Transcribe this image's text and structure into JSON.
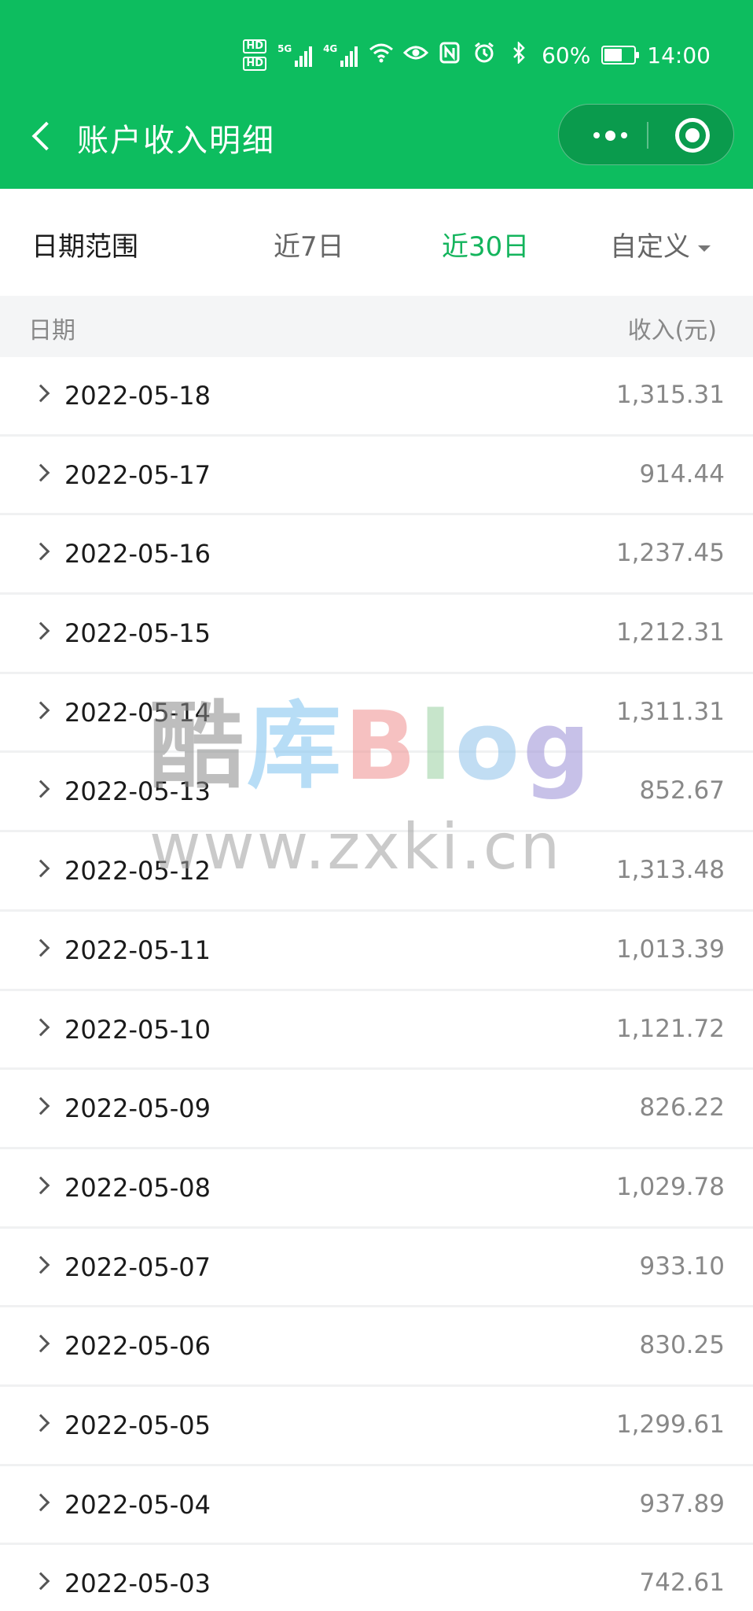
{
  "status_bar": {
    "hd_labels": [
      "HD",
      "HD"
    ],
    "network_1": "5G",
    "network_2": "4G",
    "battery_text": "60%",
    "battery_level": 0.6,
    "time": "14:00"
  },
  "header": {
    "title": "账户收入明细",
    "back_icon": "chevron-left-icon",
    "more_icon": "more-dots-icon",
    "close_icon": "target-icon"
  },
  "filter": {
    "label": "日期范围",
    "options": [
      "近7日",
      "近30日",
      "自定义"
    ],
    "active_option": "近30日"
  },
  "table": {
    "columns": [
      "日期",
      "收入(元)"
    ],
    "rows": [
      {
        "date": "2022-05-18",
        "amount": "1,315.31"
      },
      {
        "date": "2022-05-17",
        "amount": "914.44"
      },
      {
        "date": "2022-05-16",
        "amount": "1,237.45"
      },
      {
        "date": "2022-05-15",
        "amount": "1,212.31"
      },
      {
        "date": "2022-05-14",
        "amount": "1,311.31"
      },
      {
        "date": "2022-05-13",
        "amount": "852.67"
      },
      {
        "date": "2022-05-12",
        "amount": "1,313.48"
      },
      {
        "date": "2022-05-11",
        "amount": "1,013.39"
      },
      {
        "date": "2022-05-10",
        "amount": "1,121.72"
      },
      {
        "date": "2022-05-09",
        "amount": "826.22"
      },
      {
        "date": "2022-05-08",
        "amount": "1,029.78"
      },
      {
        "date": "2022-05-07",
        "amount": "933.10"
      },
      {
        "date": "2022-05-06",
        "amount": "830.25"
      },
      {
        "date": "2022-05-05",
        "amount": "1,299.61"
      },
      {
        "date": "2022-05-04",
        "amount": "937.89"
      },
      {
        "date": "2022-05-03",
        "amount": "742.61"
      }
    ]
  },
  "watermark": {
    "brand_cn_1": "酷",
    "brand_cn_2": "库",
    "brand_b": "B",
    "brand_l": "l",
    "brand_o": "o",
    "brand_g": "g",
    "url": "www.zxki.cn"
  },
  "colors": {
    "header_green": "#0dbd5f",
    "active_green": "#13b45c",
    "amount_gray": "#888888"
  }
}
